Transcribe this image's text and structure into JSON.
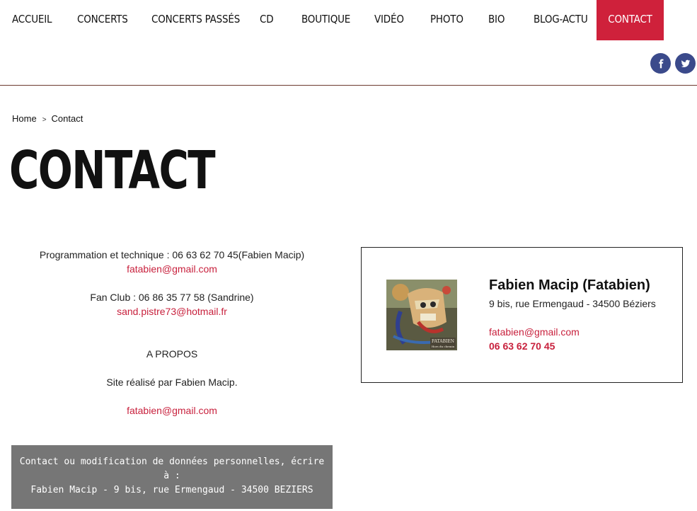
{
  "nav": {
    "items": [
      {
        "label": "ACCUEIL"
      },
      {
        "label": "CONCERTS"
      },
      {
        "label": "CONCERTS PASSÉS"
      },
      {
        "label": "CD"
      },
      {
        "label": "BOUTIQUE"
      },
      {
        "label": "VIDÉO"
      },
      {
        "label": "PHOTO"
      },
      {
        "label": "BIO"
      },
      {
        "label": "BLOG-ACTU"
      },
      {
        "label": "CONTACT",
        "active": true
      }
    ],
    "active_color": "#cf213b"
  },
  "social": {
    "facebook_icon": "facebook-icon",
    "twitter_icon": "twitter-icon",
    "color": "#3b4a8b"
  },
  "breadcrumb": {
    "home": "Home",
    "separator": ">",
    "current": "Contact"
  },
  "page_title": "CONTACT",
  "contacts": {
    "programmation": "Programmation et technique : 06 63 62 70 45(Fabien Macip)",
    "programmation_email": "fatabien@gmail.com",
    "fanclub": "Fan Club : 06 86 35 77 58 (Sandrine)",
    "fanclub_email": "sand.pistre73@hotmail.fr",
    "apropos_heading": "A PROPOS",
    "site_credit": "Site réalisé par Fabien Macip.",
    "credit_email": "fatabien@gmail.com"
  },
  "notice": {
    "line1": "Contact ou modification de données personnelles, écrire",
    "line2": "à :",
    "line3": "Fabien Macip - 9 bis, rue Ermengaud - 34500 BEZIERS"
  },
  "card": {
    "name": "Fabien Macip (Fatabien)",
    "address": "9 bis, rue Ermengaud - 34500 Béziers",
    "email": "fatabien@gmail.com",
    "phone": "06 63 62 70 45",
    "image_text_1": "FATABIEN",
    "image_text_2": "Hors du chemin"
  },
  "colors": {
    "accent": "#c8213d",
    "notice_bg": "#767676"
  }
}
